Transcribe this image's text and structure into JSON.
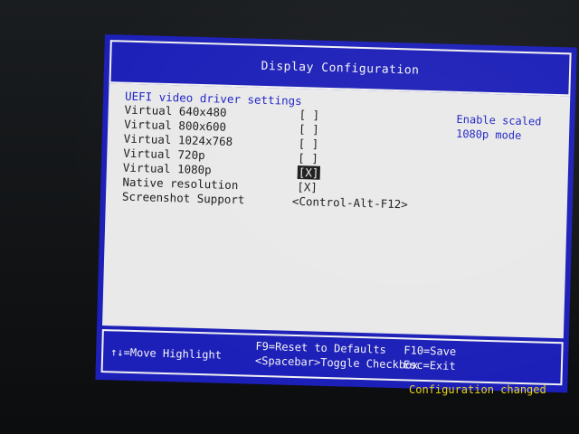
{
  "window": {
    "title": "Display Configuration"
  },
  "settings": {
    "heading": "UEFI video driver settings",
    "options": [
      {
        "label": "Virtual 640x480",
        "value": "[ ]"
      },
      {
        "label": "Virtual 800x600",
        "value": "[ ]"
      },
      {
        "label": "Virtual 1024x768",
        "value": "[ ]"
      },
      {
        "label": "Virtual 720p",
        "value": "[ ]"
      },
      {
        "label": "Virtual 1080p",
        "value": "[X]"
      },
      {
        "label": "Native resolution",
        "value": "[X]"
      },
      {
        "label": "Screenshot Support",
        "value": "<Control-Alt-F12>"
      }
    ],
    "help": "Enable scaled 1080p mode"
  },
  "footer": {
    "move": "↑↓=Move Highlight",
    "reset": "F9=Reset to Defaults",
    "toggle": "<Spacebar>Toggle Checkbox",
    "save": "F10=Save",
    "exit": "Esc=Exit"
  },
  "status": {
    "message": "Configuration changed"
  },
  "colors": {
    "background_blue": "#1d20b8",
    "panel_grey": "#e9e9ea",
    "accent_blue": "#1d22c4",
    "status_yellow": "#e8d21e"
  }
}
